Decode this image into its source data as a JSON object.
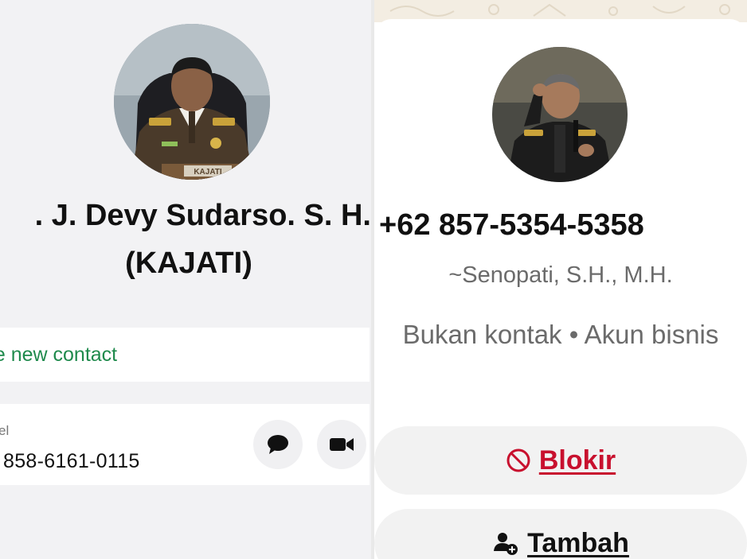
{
  "left_contact": {
    "name_line1": ". J. Devy Sudarso. S. H.",
    "name_line2": "(KAJATI)",
    "create_contact_label": "ate new contact",
    "phone_label": "el",
    "phone_number": "858-6161-0115",
    "avatar_badge_text": "KAJATI"
  },
  "left_actions": {
    "message_icon": "chat-bubble-icon",
    "video_icon": "video-camera-icon"
  },
  "right_contact": {
    "phone_title": "+62 857-5354-5358",
    "push_name": "~Senopati, S.H., M.H.",
    "subtitle": "Bukan kontak • Akun bisnis"
  },
  "right_actions": {
    "block_label": "Blokir",
    "block_icon": "prohibited-icon",
    "add_label": "Tambah",
    "add_icon": "add-person-icon"
  },
  "colors": {
    "accent_green": "#1f8a4c",
    "danger_red": "#c8102e",
    "pane_bg": "#f2f2f4"
  }
}
